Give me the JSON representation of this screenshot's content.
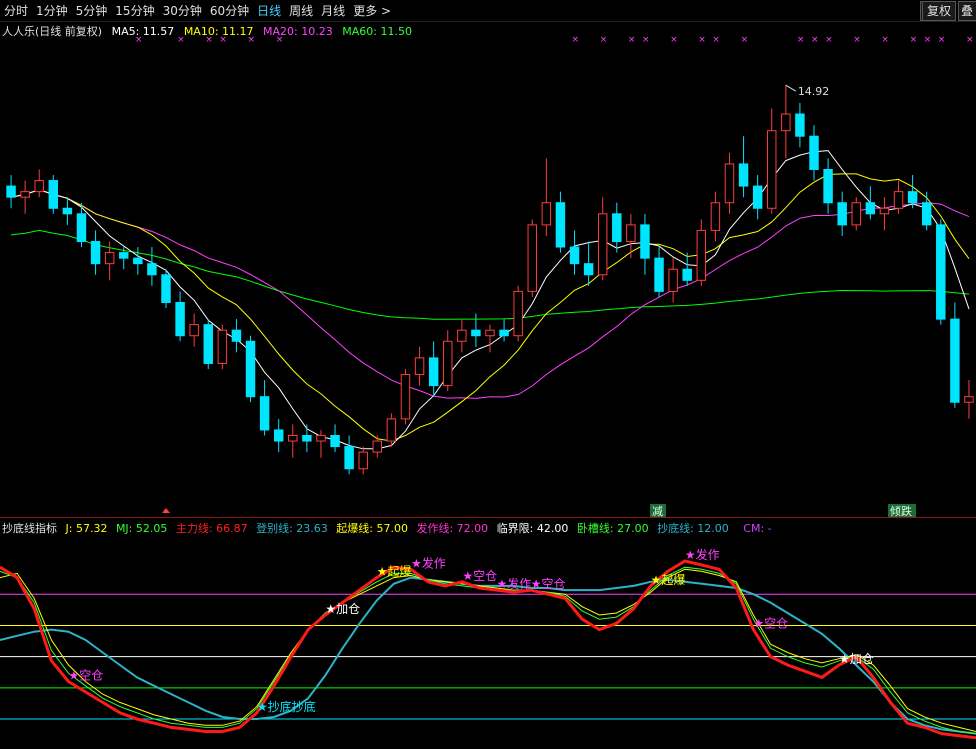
{
  "toolbar": {
    "tabs": [
      "分时",
      "1分钟",
      "5分钟",
      "15分钟",
      "30分钟",
      "60分钟",
      "日线",
      "周线",
      "月线",
      "更多"
    ],
    "active_tab": "日线",
    "more_arrow": ">",
    "restore_btn": "复权",
    "overlay_btn": "叠",
    "nav_arrow": "▶"
  },
  "main_legend": {
    "title": "人人乐(日线 前复权)",
    "ma5": "MA5: 11.57",
    "ma10": "MA10: 11.17",
    "ma20": "MA20: 10.23",
    "ma60": "MA60: 11.50"
  },
  "indicator_legend": {
    "name": "抄底线指标",
    "j": "J: 57.32",
    "mj": "MJ: 52.05",
    "zhuli": "主力线: 66.87",
    "dengbie": "登别线: 23.63",
    "qibao": "起爆线: 57.00",
    "fazuo": "发作线: 72.00",
    "linjie": "临界限: 42.00",
    "wocao": "卧槽线: 27.00",
    "chaodi": "抄底线: 12.00",
    "cm": "CM: -"
  },
  "annotations": {
    "high_label": "14.92",
    "jian": "减",
    "qingdie": "倾跌",
    "top_mark": "×"
  },
  "colors": {
    "up": "#ff3c3c",
    "down": "#00e5ff",
    "ma5": "#ffffff",
    "ma10": "#ffff00",
    "ma20": "#ff40ff",
    "ma60": "#00ff00"
  },
  "chart_data": [
    {
      "type": "candlestick",
      "title": "人人乐(日线 前复权)",
      "ylim": [
        7.4,
        15.7
      ],
      "highest": 14.92,
      "ohlc": [
        [
          13.1,
          13.3,
          12.7,
          12.9
        ],
        [
          12.9,
          13.2,
          12.6,
          13.0
        ],
        [
          13.0,
          13.4,
          12.9,
          13.2
        ],
        [
          13.2,
          13.3,
          12.6,
          12.7
        ],
        [
          12.7,
          12.9,
          12.4,
          12.6
        ],
        [
          12.6,
          12.8,
          12.0,
          12.1
        ],
        [
          12.1,
          12.3,
          11.5,
          11.7
        ],
        [
          11.7,
          12.1,
          11.4,
          11.9
        ],
        [
          11.9,
          12.0,
          11.6,
          11.8
        ],
        [
          11.8,
          12.0,
          11.5,
          11.7
        ],
        [
          11.7,
          12.0,
          11.3,
          11.5
        ],
        [
          11.5,
          11.6,
          10.9,
          11.0
        ],
        [
          11.0,
          11.2,
          10.3,
          10.4
        ],
        [
          10.4,
          10.8,
          10.2,
          10.6
        ],
        [
          10.6,
          10.7,
          9.8,
          9.9
        ],
        [
          9.9,
          10.6,
          9.8,
          10.5
        ],
        [
          10.5,
          10.7,
          10.1,
          10.3
        ],
        [
          10.3,
          10.4,
          9.2,
          9.3
        ],
        [
          9.3,
          9.6,
          8.6,
          8.7
        ],
        [
          8.7,
          8.9,
          8.3,
          8.5
        ],
        [
          8.5,
          8.8,
          8.2,
          8.6
        ],
        [
          8.6,
          8.8,
          8.3,
          8.5
        ],
        [
          8.5,
          8.7,
          8.2,
          8.6
        ],
        [
          8.6,
          8.8,
          8.3,
          8.4
        ],
        [
          8.4,
          8.6,
          7.9,
          8.0
        ],
        [
          8.0,
          8.4,
          7.9,
          8.3
        ],
        [
          8.3,
          8.6,
          8.2,
          8.5
        ],
        [
          8.5,
          9.0,
          8.4,
          8.9
        ],
        [
          8.9,
          9.8,
          8.8,
          9.7
        ],
        [
          9.7,
          10.2,
          9.5,
          10.0
        ],
        [
          10.0,
          10.3,
          9.3,
          9.5
        ],
        [
          9.5,
          10.5,
          9.4,
          10.3
        ],
        [
          10.3,
          10.7,
          10.1,
          10.5
        ],
        [
          10.5,
          10.8,
          10.2,
          10.4
        ],
        [
          10.4,
          10.6,
          10.1,
          10.5
        ],
        [
          10.5,
          10.7,
          10.3,
          10.4
        ],
        [
          10.4,
          11.3,
          10.3,
          11.2
        ],
        [
          11.2,
          12.5,
          11.1,
          12.4
        ],
        [
          12.4,
          13.6,
          12.2,
          12.8
        ],
        [
          12.8,
          13.0,
          11.9,
          12.0
        ],
        [
          12.0,
          12.3,
          11.5,
          11.7
        ],
        [
          11.7,
          12.1,
          11.3,
          11.5
        ],
        [
          11.5,
          12.9,
          11.4,
          12.6
        ],
        [
          12.6,
          12.8,
          11.9,
          12.1
        ],
        [
          12.1,
          12.6,
          11.8,
          12.4
        ],
        [
          12.4,
          12.6,
          11.5,
          11.8
        ],
        [
          11.8,
          12.0,
          11.1,
          11.2
        ],
        [
          11.2,
          11.8,
          11.0,
          11.6
        ],
        [
          11.6,
          11.9,
          11.3,
          11.4
        ],
        [
          11.4,
          12.5,
          11.3,
          12.3
        ],
        [
          12.3,
          13.0,
          12.1,
          12.8
        ],
        [
          12.8,
          13.7,
          12.6,
          13.5
        ],
        [
          13.5,
          14.0,
          12.9,
          13.1
        ],
        [
          13.1,
          13.3,
          12.5,
          12.7
        ],
        [
          12.7,
          14.5,
          12.6,
          14.1
        ],
        [
          14.1,
          14.92,
          13.6,
          14.4
        ],
        [
          14.4,
          14.6,
          13.8,
          14.0
        ],
        [
          14.0,
          14.2,
          13.2,
          13.4
        ],
        [
          13.4,
          13.6,
          12.6,
          12.8
        ],
        [
          12.8,
          13.0,
          12.2,
          12.4
        ],
        [
          12.4,
          12.9,
          12.3,
          12.8
        ],
        [
          12.8,
          13.1,
          12.5,
          12.6
        ],
        [
          12.6,
          12.9,
          12.3,
          12.7
        ],
        [
          12.7,
          13.2,
          12.6,
          13.0
        ],
        [
          13.0,
          13.3,
          12.7,
          12.8
        ],
        [
          12.8,
          13.0,
          12.3,
          12.4
        ],
        [
          12.4,
          12.5,
          10.6,
          10.7
        ],
        [
          10.7,
          11.0,
          9.1,
          9.2
        ],
        [
          9.2,
          9.6,
          8.9,
          9.3
        ]
      ]
    },
    {
      "type": "line",
      "title": "抄底线指标",
      "ylim": [
        0,
        100
      ],
      "series": [
        {
          "name": "主力线",
          "values": [
            85,
            80,
            65,
            40,
            30,
            25,
            20,
            15,
            12,
            10,
            8,
            7,
            6,
            6,
            8,
            15,
            28,
            42,
            55,
            62,
            68,
            74,
            80,
            85,
            84,
            78,
            76,
            78,
            75,
            74,
            73,
            74,
            72,
            70,
            60,
            55,
            58,
            65,
            76,
            83,
            88,
            86,
            84,
            75,
            55,
            42,
            38,
            35,
            32,
            38,
            42,
            32,
            20,
            10,
            8,
            5,
            4,
            3
          ]
        },
        {
          "name": "MJ",
          "values": [
            83,
            80,
            68,
            45,
            34,
            28,
            22,
            18,
            15,
            12,
            10,
            9,
            8,
            8,
            10,
            17,
            30,
            43,
            55,
            63,
            68,
            73,
            78,
            82,
            82,
            79,
            77,
            76,
            75,
            74,
            74,
            74,
            73,
            71,
            64,
            60,
            61,
            66,
            74,
            81,
            85,
            84,
            82,
            77,
            60,
            46,
            42,
            39,
            37,
            40,
            42,
            36,
            25,
            15,
            11,
            8,
            6,
            5
          ]
        },
        {
          "name": "J",
          "values": [
            80,
            82,
            70,
            50,
            38,
            30,
            24,
            20,
            17,
            14,
            12,
            10,
            9,
            9,
            11,
            18,
            31,
            44,
            55,
            63,
            68,
            72,
            76,
            80,
            81,
            79,
            78,
            77,
            76,
            75,
            74,
            74,
            73,
            72,
            66,
            62,
            63,
            67,
            73,
            80,
            84,
            83,
            81,
            78,
            62,
            48,
            44,
            41,
            39,
            41,
            43,
            38,
            28,
            17,
            13,
            10,
            8,
            6
          ]
        },
        {
          "name": "登别线",
          "values": [
            50,
            52,
            54,
            55,
            54,
            50,
            44,
            38,
            32,
            28,
            24,
            20,
            16,
            13,
            12,
            12,
            13,
            16,
            22,
            33,
            46,
            58,
            69,
            77,
            80,
            79,
            78,
            77,
            76,
            76,
            76,
            75,
            75,
            74,
            74,
            74,
            75,
            76,
            78,
            79,
            78,
            77,
            76,
            75,
            72,
            68,
            63,
            58,
            53,
            46,
            38,
            30,
            20,
            12,
            9,
            7,
            6,
            5
          ]
        }
      ],
      "levels": [
        {
          "name": "发作线",
          "value": 72
        },
        {
          "name": "起爆线",
          "value": 57
        },
        {
          "name": "临界限",
          "value": 42
        },
        {
          "name": "卧槽线",
          "value": 27
        },
        {
          "name": "抄底线",
          "value": 12
        }
      ],
      "signals": [
        {
          "index": 4,
          "label": "空仓"
        },
        {
          "index": 19,
          "label": "加仓"
        },
        {
          "index": 22,
          "label": "起爆"
        },
        {
          "index": 24,
          "label": "发作"
        },
        {
          "index": 27,
          "label": "空仓"
        },
        {
          "index": 29,
          "label": "发作"
        },
        {
          "index": 31,
          "label": "空仓"
        },
        {
          "index": 38,
          "label": "起爆"
        },
        {
          "index": 40,
          "label": "发作"
        },
        {
          "index": 44,
          "label": "空仓"
        },
        {
          "index": 49,
          "label": "加仓"
        },
        {
          "index": 15,
          "label": "抄底抄底"
        }
      ]
    }
  ]
}
